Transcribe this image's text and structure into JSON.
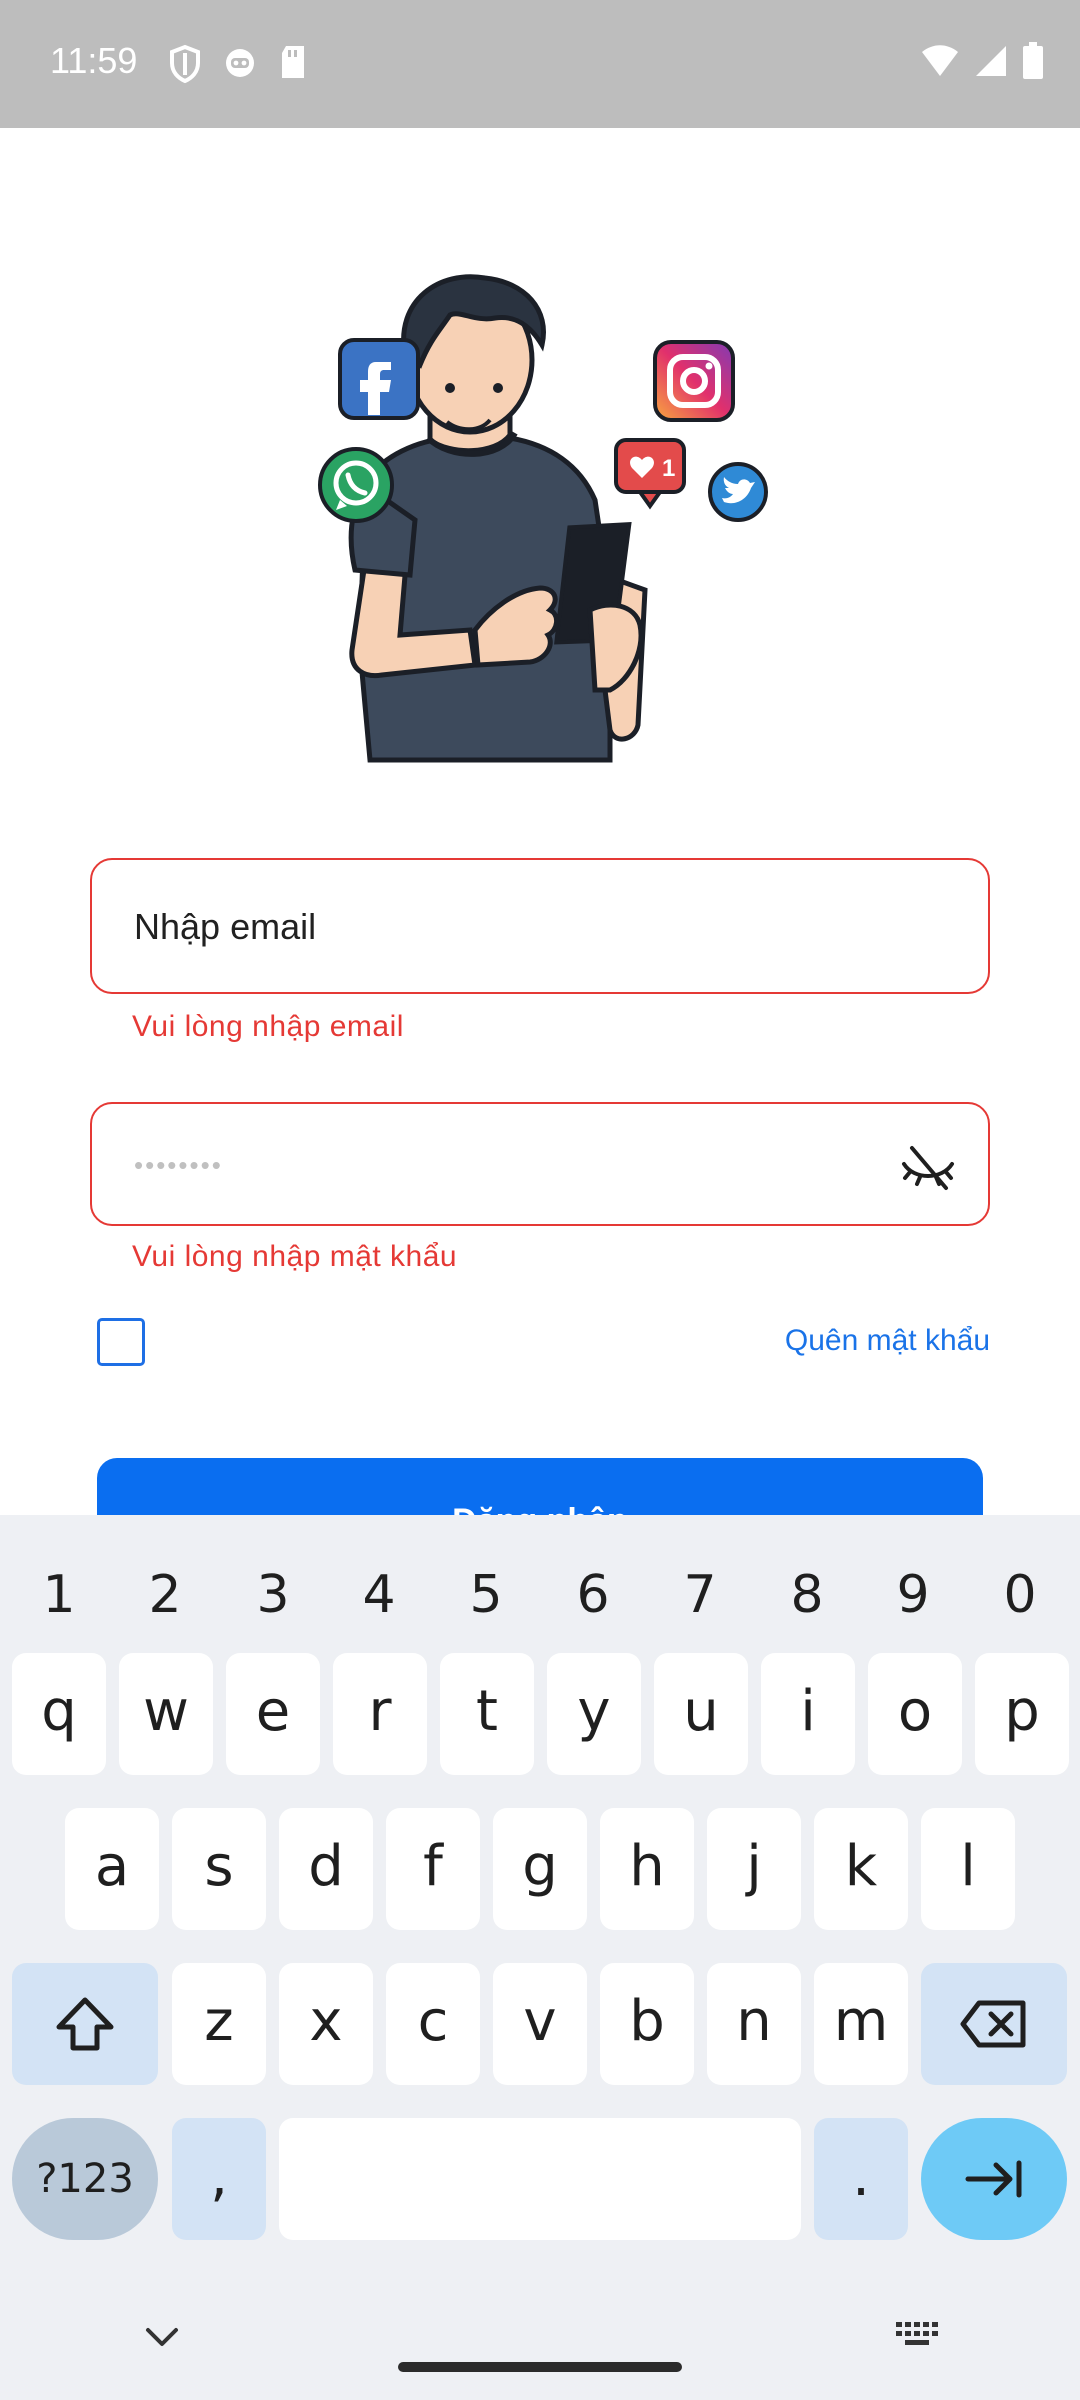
{
  "status_bar": {
    "time": "11:59",
    "left_icons": [
      "shield-icon",
      "robot-icon",
      "sd-card-icon"
    ],
    "right_icons": [
      "wifi-icon",
      "signal-icon",
      "battery-icon"
    ]
  },
  "illustration": {
    "description_icons": [
      "facebook-icon",
      "instagram-icon",
      "whatsapp-icon",
      "twitter-icon",
      "like-notification-icon"
    ],
    "like_count": "1"
  },
  "form": {
    "email_value": "Nhập email",
    "email_error": "Vui lòng nhập email",
    "password_placeholder": "••••••••",
    "password_error": "Vui lòng nhập mật khẩu",
    "forgot_password": "Quên mật khẩu",
    "login_button": "Đăng nhập"
  },
  "keyboard": {
    "numbers": [
      "1",
      "2",
      "3",
      "4",
      "5",
      "6",
      "7",
      "8",
      "9",
      "0"
    ],
    "row1": [
      "q",
      "w",
      "e",
      "r",
      "t",
      "y",
      "u",
      "i",
      "o",
      "p"
    ],
    "row2": [
      "a",
      "s",
      "d",
      "f",
      "g",
      "h",
      "j",
      "k",
      "l"
    ],
    "row3": [
      "z",
      "x",
      "c",
      "v",
      "b",
      "n",
      "m"
    ],
    "symbols_key": "?123",
    "comma_key": ",",
    "period_key": "."
  },
  "colors": {
    "error": "#e53935",
    "primary": "#0a6ef0",
    "link": "#1a73e8"
  }
}
